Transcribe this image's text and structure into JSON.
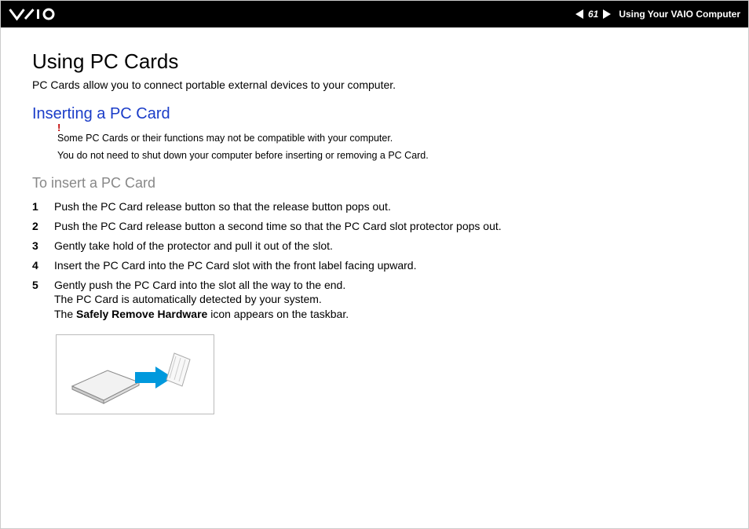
{
  "header": {
    "page_number": "61",
    "breadcrumb": "Using Your VAIO Computer"
  },
  "content": {
    "h1": "Using PC Cards",
    "intro": "PC Cards allow you to connect portable external devices to your computer.",
    "h2": "Inserting a PC Card",
    "notes": [
      "Some PC Cards or their functions may not be compatible with your computer.",
      "You do not need to shut down your computer before inserting or removing a PC Card."
    ],
    "h3": "To insert a PC Card",
    "steps": [
      {
        "n": "1",
        "text": "Push the PC Card release button so that the release button pops out."
      },
      {
        "n": "2",
        "text": "Push the PC Card release button a second time so that the PC Card slot protector pops out."
      },
      {
        "n": "3",
        "text": "Gently take hold of the protector and pull it out of the slot."
      },
      {
        "n": "4",
        "text": "Insert the PC Card into the PC Card slot with the front label facing upward."
      },
      {
        "n": "5",
        "text_a": "Gently push the PC Card into the slot all the way to the end.",
        "text_b": "The PC Card is automatically detected by your system.",
        "text_c_pre": "The ",
        "text_c_bold": "Safely Remove Hardware",
        "text_c_post": " icon appears on the taskbar."
      }
    ]
  }
}
